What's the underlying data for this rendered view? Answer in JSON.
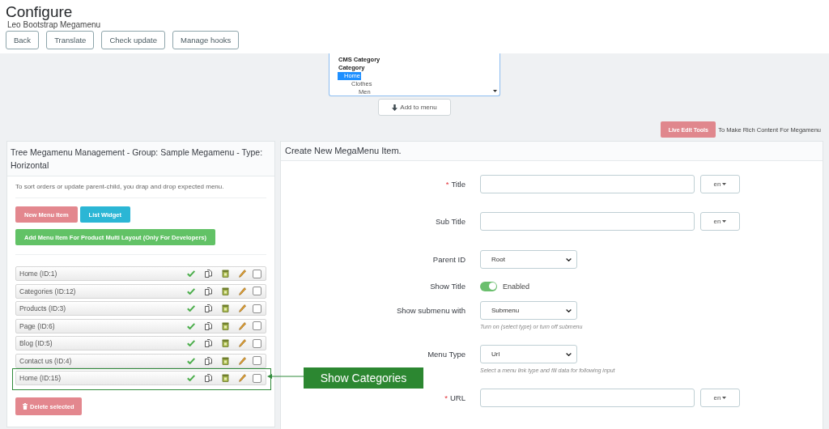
{
  "header": {
    "title": "Configure",
    "subtitle": "Leo Bootstrap Megamenu",
    "buttons": [
      "Back",
      "Translate",
      "Check update",
      "Manage hooks"
    ]
  },
  "picker": {
    "options": [
      {
        "kind": "group",
        "label": "CMS Category"
      },
      {
        "kind": "group",
        "label": "Category",
        "children": [
          {
            "kind": "option",
            "label": "Home",
            "selected": true,
            "children": [
              {
                "kind": "option",
                "label": "Clothes",
                "selected": false,
                "children": [
                  {
                    "kind": "option",
                    "label": "Men",
                    "selected": false
                  }
                ]
              }
            ]
          }
        ]
      }
    ],
    "add_button": "Add to menu"
  },
  "live_edit": {
    "button": "Live Edit Tools",
    "note": "To Make Rich Content For Megamenu"
  },
  "tree_panel": {
    "title": "Tree Megamenu Management - Group: Sample Megamenu - Type: Horizontal",
    "description": "To sort orders or update parent-child, you drap and drop expected menu.",
    "buttons": [
      {
        "label": "New Menu Item",
        "kind": "danger"
      },
      {
        "label": "List Widget",
        "kind": "info"
      },
      {
        "label": "Add Menu Item For Product Multi Layout (Only For Developers)",
        "kind": "success"
      }
    ],
    "items": [
      {
        "label": "Home (ID:1)",
        "active": true,
        "checked": false
      },
      {
        "label": "Categories (ID:12)",
        "active": true,
        "checked": false
      },
      {
        "label": "Products (ID:3)",
        "active": true,
        "checked": false
      },
      {
        "label": "Page (ID:6)",
        "active": true,
        "checked": false
      },
      {
        "label": "Blog (ID:5)",
        "active": true,
        "checked": false
      },
      {
        "label": "Contact us (ID:4)",
        "active": true,
        "checked": false
      },
      {
        "label": "Home (ID:15)",
        "active": true,
        "checked": false,
        "callout": "Show Categories"
      }
    ],
    "delete_button": "Delete selected"
  },
  "form_panel": {
    "title": "Create New MegaMenu Item.",
    "fields": [
      {
        "kind": "text",
        "required_mark": "*",
        "label": "Title",
        "lang": "en"
      },
      {
        "kind": "text",
        "label": "Sub Title",
        "lang": "en"
      },
      {
        "kind": "select",
        "label": "Parent ID",
        "value": "Root"
      },
      {
        "kind": "switch",
        "label": "Show Title",
        "on": true,
        "state_label": "Enabled"
      },
      {
        "kind": "select",
        "label": "Show submenu with",
        "value": "Submenu",
        "help": "Turn on (select type) or turn off submenu"
      },
      {
        "kind": "select",
        "label": "Menu Type",
        "value": "Url",
        "help": "Select a menu link type and fill data for following input"
      },
      {
        "kind": "text",
        "required_mark": "*",
        "label": "URL",
        "lang": "en"
      }
    ]
  }
}
